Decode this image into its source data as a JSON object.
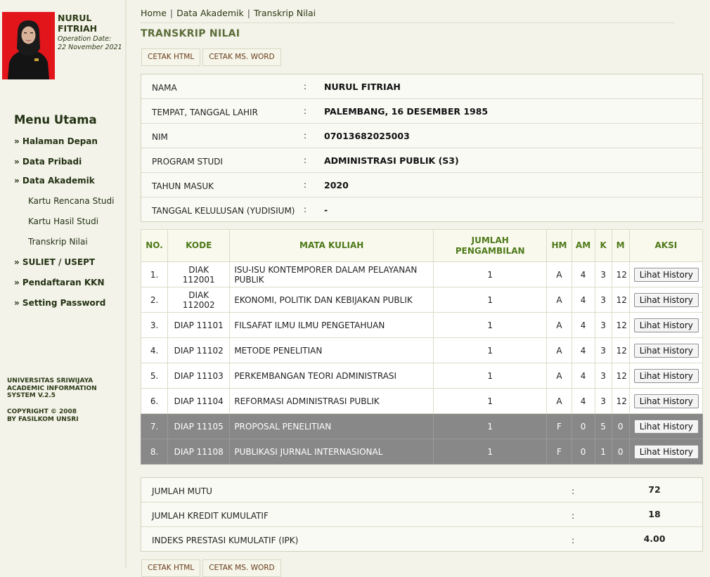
{
  "profile": {
    "name": "NURUL FITRIAH",
    "operation_label": "Operation Date:",
    "operation_date": "22 November 2021"
  },
  "menu": {
    "title": "Menu Utama",
    "items": [
      {
        "label": "» Halaman Depan"
      },
      {
        "label": "» Data Pribadi"
      },
      {
        "label": "» Data Akademik"
      },
      {
        "label": "» SULIET / USEPT"
      },
      {
        "label": "» Pendaftaran KKN"
      },
      {
        "label": "» Setting Password"
      }
    ],
    "subitems": [
      {
        "label": "Kartu Rencana Studi"
      },
      {
        "label": "Kartu Hasil Studi"
      },
      {
        "label": "Transkrip Nilai"
      }
    ]
  },
  "footer": {
    "line1": "UNIVERSITAS SRIWIJAYA",
    "line2": "ACADEMIC INFORMATION",
    "line3": "SYSTEM V.2.5",
    "line4": "COPYRIGHT © 2008",
    "line5": "BY FASILKOM UNSRI"
  },
  "breadcrumb": [
    "Home",
    "Data Akademik",
    "Transkrip Nilai"
  ],
  "breadcrumb_sep": "|",
  "page_title": "TRANSKRIP NILAI",
  "buttons": {
    "cetak_html": "CETAK HTML",
    "cetak_word": "CETAK MS. WORD"
  },
  "colon": ":",
  "info": [
    {
      "label": "NAMA",
      "value": "NURUL FITRIAH"
    },
    {
      "label": "TEMPAT, TANGGAL LAHIR",
      "value": "PALEMBANG, 16 DESEMBER 1985"
    },
    {
      "label": "NIM",
      "value": "07013682025003"
    },
    {
      "label": "PROGRAM STUDI",
      "value": "ADMINISTRASI PUBLIK (S3)"
    },
    {
      "label": "TAHUN MASUK",
      "value": "2020"
    },
    {
      "label": "TANGGAL KELULUSAN (YUDISIUM)",
      "value": "-"
    }
  ],
  "table": {
    "headers": {
      "no": "NO.",
      "kode": "KODE",
      "mk": "MATA KULIAH",
      "jumlah1": "JUMLAH",
      "jumlah2": "PENGAMBILAN",
      "hm": "HM",
      "am": "AM",
      "k": "K",
      "m": "M",
      "aksi": "AKSI"
    },
    "action_label": "Lihat History",
    "rows": [
      {
        "no": "1.",
        "kode": "DIAK 112001",
        "mk": "ISU-ISU KONTEMPORER DALAM PELAYANAN PUBLIK",
        "jml": "1",
        "hm": "A",
        "am": "4",
        "k": "3",
        "m": "12",
        "fail": false
      },
      {
        "no": "2.",
        "kode": "DIAK 112002",
        "mk": "EKONOMI, POLITIK DAN KEBIJAKAN PUBLIK",
        "jml": "1",
        "hm": "A",
        "am": "4",
        "k": "3",
        "m": "12",
        "fail": false
      },
      {
        "no": "3.",
        "kode": "DIAP 11101",
        "mk": "FILSAFAT ILMU ILMU PENGETAHUAN",
        "jml": "1",
        "hm": "A",
        "am": "4",
        "k": "3",
        "m": "12",
        "fail": false
      },
      {
        "no": "4.",
        "kode": "DIAP 11102",
        "mk": "METODE PENELITIAN",
        "jml": "1",
        "hm": "A",
        "am": "4",
        "k": "3",
        "m": "12",
        "fail": false
      },
      {
        "no": "5.",
        "kode": "DIAP 11103",
        "mk": "PERKEMBANGAN TEORI ADMINISTRASI",
        "jml": "1",
        "hm": "A",
        "am": "4",
        "k": "3",
        "m": "12",
        "fail": false
      },
      {
        "no": "6.",
        "kode": "DIAP 11104",
        "mk": "REFORMASI ADMINISTRASI PUBLIK",
        "jml": "1",
        "hm": "A",
        "am": "4",
        "k": "3",
        "m": "12",
        "fail": false
      },
      {
        "no": "7.",
        "kode": "DIAP 11105",
        "mk": "PROPOSAL PENELITIAN",
        "jml": "1",
        "hm": "F",
        "am": "0",
        "k": "5",
        "m": "0",
        "fail": true
      },
      {
        "no": "8.",
        "kode": "DIAP 11108",
        "mk": "PUBLIKASI JURNAL INTERNASIONAL",
        "jml": "1",
        "hm": "F",
        "am": "0",
        "k": "1",
        "m": "0",
        "fail": true
      }
    ]
  },
  "summary": [
    {
      "label": "JUMLAH MUTU",
      "value": "72"
    },
    {
      "label": "JUMLAH KREDIT KUMULATIF",
      "value": "18"
    },
    {
      "label": "INDEKS PRESTASI KUMULATIF (IPK)",
      "value": "4.00"
    }
  ],
  "colors": {
    "fail_row": "#888888",
    "header_text": "#4f7a1a",
    "photo_bg": "#e2151b"
  }
}
